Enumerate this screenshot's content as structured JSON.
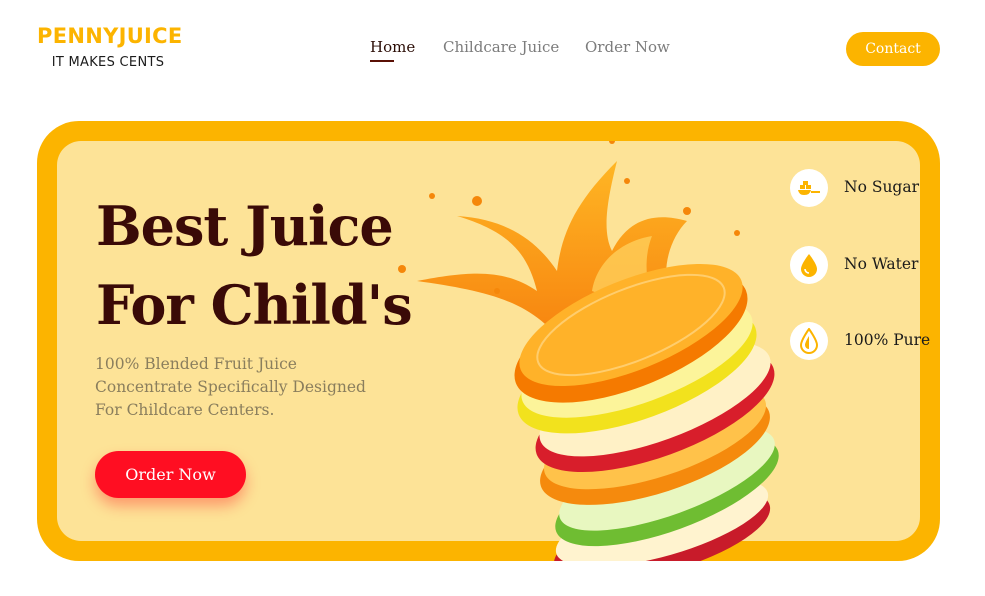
{
  "brand": {
    "name": "PENNYJUICE",
    "tagline": "IT MAKES CENTS"
  },
  "nav": {
    "items": [
      {
        "label": "Home",
        "active": true
      },
      {
        "label": "Childcare Juice",
        "active": false
      },
      {
        "label": "Order Now",
        "active": false
      }
    ],
    "contact_label": "Contact"
  },
  "hero": {
    "title_line1": "Best Juice",
    "title_line2": "For Child's",
    "description": "100% Blended Fruit Juice Concentrate Specifically Designed For Childcare Centers.",
    "cta_label": "Order Now",
    "image": "fruit-slices-juice-splash"
  },
  "features": [
    {
      "label": "No Sugar",
      "icon": "sugar-spoon-icon"
    },
    {
      "label": "No Water",
      "icon": "water-drop-icon"
    },
    {
      "label": "100% Pure",
      "icon": "pure-drop-icon"
    }
  ],
  "colors": {
    "brand_yellow": "#fcb400",
    "hero_panel": "#fde397",
    "headline": "#3a0a07",
    "cta_red": "#ff0e22"
  }
}
